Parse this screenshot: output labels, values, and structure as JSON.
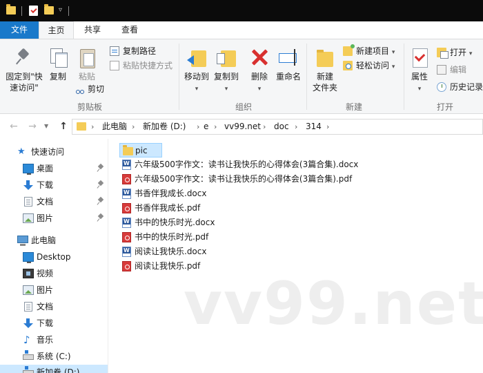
{
  "tabs": {
    "file": "文件",
    "home": "主页",
    "share": "共享",
    "view": "查看"
  },
  "ribbon": {
    "clipboard": {
      "pin_label": "固定到\"快\n速访问\"",
      "copy_label": "复制",
      "paste_label": "粘贴",
      "copy_path_label": "复制路径",
      "paste_shortcut_label": "粘贴快捷方式",
      "cut_label": "剪切",
      "group_label": "剪贴板"
    },
    "organize": {
      "move_to_label": "移动到",
      "copy_to_label": "复制到",
      "delete_label": "删除",
      "rename_label": "重命名",
      "group_label": "组织"
    },
    "new": {
      "new_folder_label": "新建\n文件夹",
      "new_item_label": "新建项目",
      "easy_access_label": "轻松访问",
      "group_label": "新建"
    },
    "open": {
      "properties_label": "属性",
      "open_label": "打开",
      "edit_label": "编辑",
      "history_label": "历史记录",
      "group_label": "打开"
    }
  },
  "address_bar": {
    "crumbs": [
      "此电脑",
      "新加卷 (D:)",
      "e",
      "vv99.net",
      "doc",
      "314"
    ]
  },
  "sidebar": {
    "quick_access": "快速访问",
    "pinned": [
      "桌面",
      "下载",
      "文档",
      "图片"
    ],
    "this_pc": "此电脑",
    "pc_items": [
      "Desktop",
      "视频",
      "图片",
      "文档",
      "下载",
      "音乐",
      "系统 (C:)",
      "新加卷 (D:)"
    ]
  },
  "files": [
    {
      "name": "pic",
      "type": "folder"
    },
    {
      "name": "六年级500字作文：读书让我快乐的心得体会(3篇合集).docx",
      "type": "docx"
    },
    {
      "name": "六年级500字作文：读书让我快乐的心得体会(3篇合集).pdf",
      "type": "pdf"
    },
    {
      "name": "书香伴我成长.docx",
      "type": "docx"
    },
    {
      "name": "书香伴我成长.pdf",
      "type": "pdf"
    },
    {
      "name": "书中的快乐时光.docx",
      "type": "docx"
    },
    {
      "name": "书中的快乐时光.pdf",
      "type": "pdf"
    },
    {
      "name": "阅读让我快乐.docx",
      "type": "docx"
    },
    {
      "name": "阅读让我快乐.pdf",
      "type": "pdf"
    }
  ],
  "watermark": "vv99.net",
  "colors": {
    "file_tab": "#1979ca",
    "selection": "#cce8ff",
    "folder": "#f4cc57",
    "pdf": "#d83b3b",
    "delete": "#d8302f"
  }
}
